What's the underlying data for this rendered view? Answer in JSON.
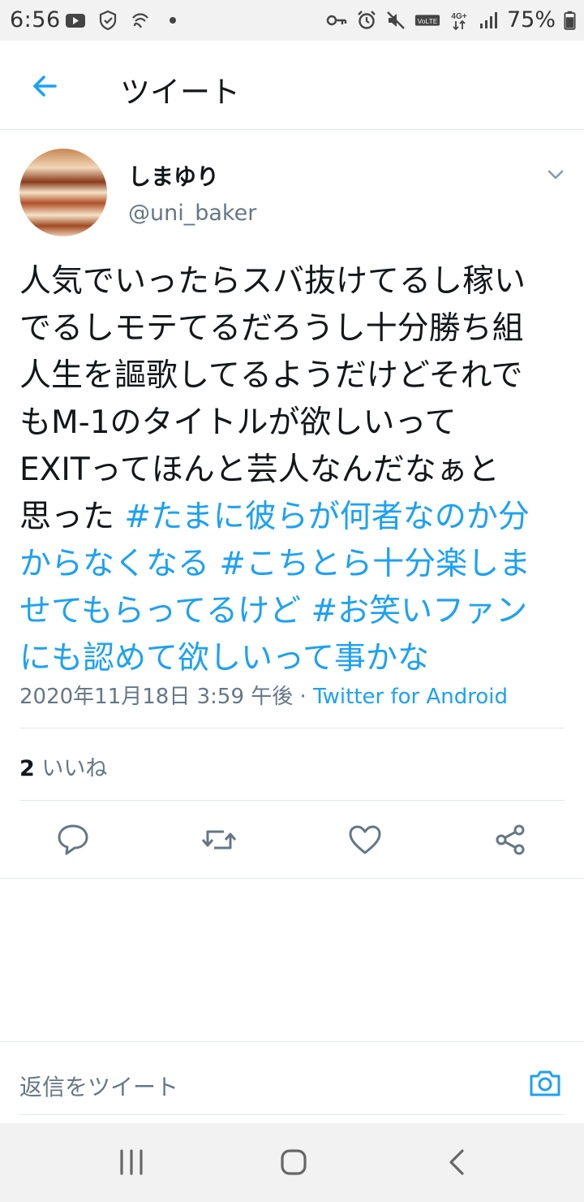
{
  "status_bar": {
    "time": "6:56",
    "battery": "75%",
    "left_icons": [
      "youtube-icon",
      "shield-icon",
      "wifi-calling-icon",
      "dot-icon"
    ],
    "right_icons": [
      "vpn-key-icon",
      "alarm-icon",
      "mute-icon",
      "volte-icon",
      "4g-icon",
      "signal-icon",
      "battery-icon"
    ],
    "network_label": "4G+",
    "volte_label": "VoLTE"
  },
  "header": {
    "title": "ツイート"
  },
  "tweet": {
    "display_name": "しまゆり",
    "handle": "@uni_baker",
    "text_lines": [
      [
        {
          "t": "人気でいったらスバ抜けてるし稼い",
          "tag": false
        }
      ],
      [
        {
          "t": "でるしモテてるだろうし十分勝ち組",
          "tag": false
        }
      ],
      [
        {
          "t": "人生を謳歌してるようだけどそれで",
          "tag": false
        }
      ],
      [
        {
          "t": "もM-1のタイトルが欲しいって",
          "tag": false
        }
      ],
      [
        {
          "t": "EXITってほんと芸人なんだなぁと",
          "tag": false
        }
      ],
      [
        {
          "t": "思った ",
          "tag": false
        },
        {
          "t": "#たまに彼らが何者なのか分",
          "tag": true
        }
      ],
      [
        {
          "t": "からなくなる #こちとら十分楽しま",
          "tag": true
        }
      ],
      [
        {
          "t": "せてもらってるけど #お笑いファン",
          "tag": true
        }
      ],
      [
        {
          "t": "にも認めて欲しいって事かな",
          "tag": true
        }
      ]
    ],
    "timestamp": "2020年11月18日 3:59 午後",
    "separator": " · ",
    "source": "Twitter for Android",
    "likes_count": "2",
    "likes_label": " いいね"
  },
  "colors": {
    "accent": "#1da1f2",
    "secondary_text": "#657786",
    "divider": "#e1e8ed"
  },
  "reply": {
    "placeholder": "返信をツイート"
  }
}
